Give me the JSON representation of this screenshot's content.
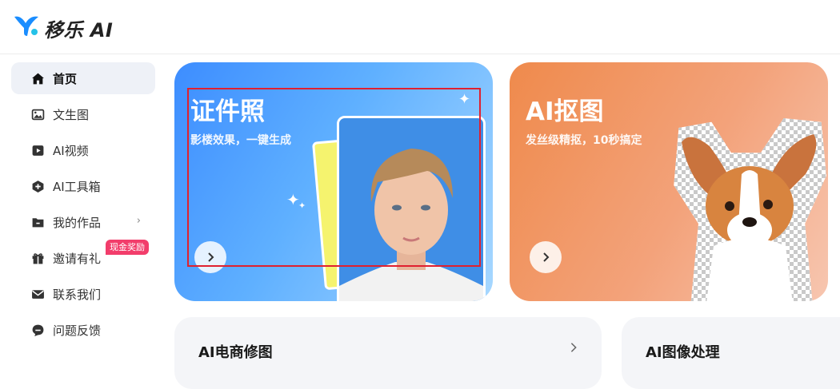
{
  "app": {
    "name": "移乐 AI"
  },
  "sidebar": {
    "items": [
      {
        "label": "首页",
        "icon": "home-icon",
        "active": true
      },
      {
        "label": "文生图",
        "icon": "image-icon"
      },
      {
        "label": "AI视频",
        "icon": "video-icon"
      },
      {
        "label": "AI工具箱",
        "icon": "toolbox-icon"
      },
      {
        "label": "我的作品",
        "icon": "folder-icon",
        "has_chevron": true
      },
      {
        "label": "邀请有礼",
        "icon": "gift-icon",
        "badge": "现金奖励"
      },
      {
        "label": "联系我们",
        "icon": "mail-icon"
      },
      {
        "label": "问题反馈",
        "icon": "feedback-icon"
      }
    ]
  },
  "cards": {
    "id_photo": {
      "title": "证件照",
      "subtitle": "影楼效果，一键生成"
    },
    "cutout": {
      "title": "AI抠图",
      "subtitle": "发丝级精抠，10秒搞定"
    }
  },
  "sections": {
    "ecommerce": {
      "title": "AI电商修图"
    },
    "image_processing": {
      "title": "AI图像处理"
    }
  },
  "colors": {
    "accent_blue": "#3d8dff",
    "accent_orange": "#ef8a4c",
    "badge_pink": "#f23d6b",
    "highlight_red": "#e0202f"
  }
}
